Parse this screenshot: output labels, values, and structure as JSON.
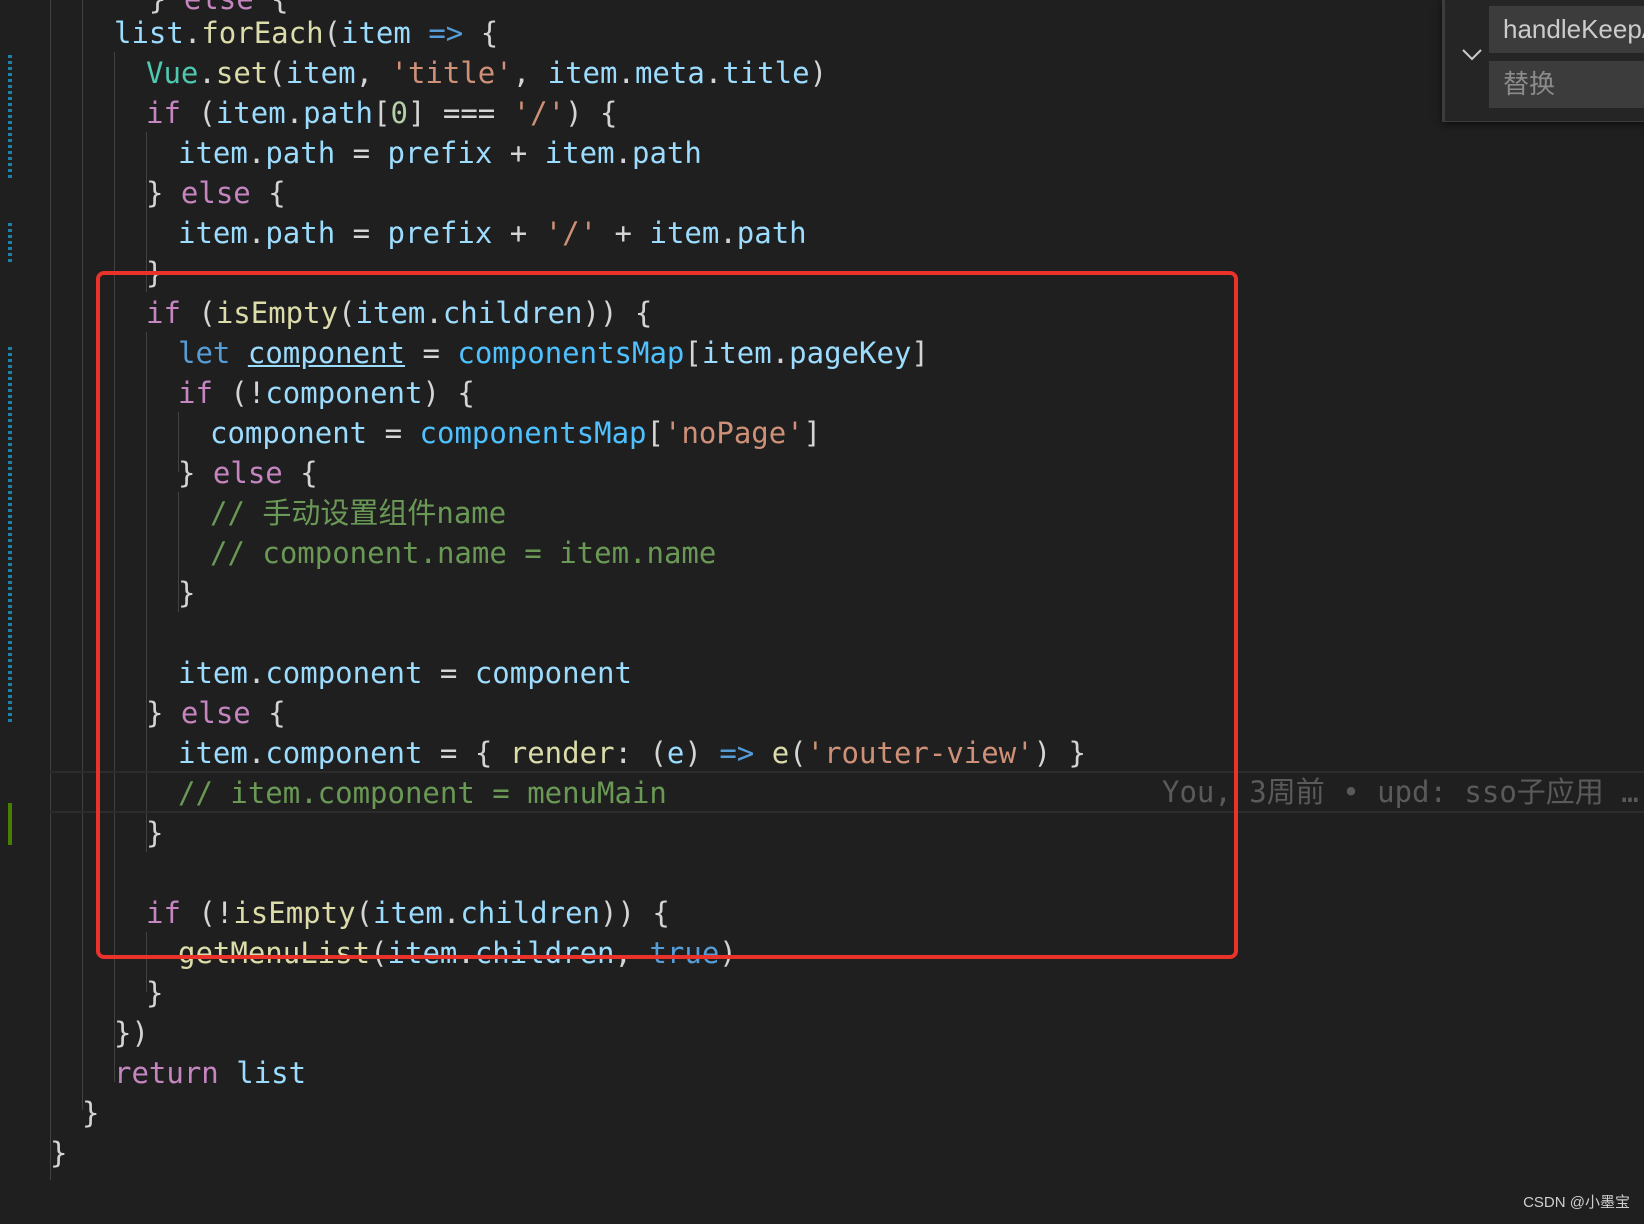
{
  "editor": {
    "lines": [
      [
        [
          "op",
          "  } "
        ],
        [
          "kw",
          "else"
        ],
        [
          "op",
          " {"
        ]
      ],
      [
        [
          "var",
          "list"
        ],
        [
          "op",
          "."
        ],
        [
          "fn",
          "forEach"
        ],
        [
          "op",
          "("
        ],
        [
          "var",
          "item"
        ],
        [
          "op",
          " "
        ],
        [
          "kwb",
          "=>"
        ],
        [
          "op",
          " {"
        ]
      ],
      [
        [
          "cls",
          "Vue"
        ],
        [
          "op",
          "."
        ],
        [
          "fn",
          "set"
        ],
        [
          "op",
          "("
        ],
        [
          "var",
          "item"
        ],
        [
          "op",
          ", "
        ],
        [
          "str",
          "'title'"
        ],
        [
          "op",
          ", "
        ],
        [
          "var",
          "item"
        ],
        [
          "op",
          "."
        ],
        [
          "var",
          "meta"
        ],
        [
          "op",
          "."
        ],
        [
          "var",
          "title"
        ],
        [
          "op",
          ")"
        ]
      ],
      [
        [
          "kw",
          "if"
        ],
        [
          "op",
          " ("
        ],
        [
          "var",
          "item"
        ],
        [
          "op",
          "."
        ],
        [
          "var",
          "path"
        ],
        [
          "op",
          "["
        ],
        [
          "num",
          "0"
        ],
        [
          "op",
          "] === "
        ],
        [
          "str",
          "'/'"
        ],
        [
          "op",
          ") {"
        ]
      ],
      [
        [
          "var",
          "item"
        ],
        [
          "op",
          "."
        ],
        [
          "var",
          "path"
        ],
        [
          "op",
          " = "
        ],
        [
          "var",
          "prefix"
        ],
        [
          "op",
          " + "
        ],
        [
          "var",
          "item"
        ],
        [
          "op",
          "."
        ],
        [
          "var",
          "path"
        ]
      ],
      [
        [
          "op",
          "} "
        ],
        [
          "kw",
          "else"
        ],
        [
          "op",
          " {"
        ]
      ],
      [
        [
          "var",
          "item"
        ],
        [
          "op",
          "."
        ],
        [
          "var",
          "path"
        ],
        [
          "op",
          " = "
        ],
        [
          "var",
          "prefix"
        ],
        [
          "op",
          " + "
        ],
        [
          "str",
          "'/'"
        ],
        [
          "op",
          " + "
        ],
        [
          "var",
          "item"
        ],
        [
          "op",
          "."
        ],
        [
          "var",
          "path"
        ]
      ],
      [
        [
          "op",
          "}"
        ]
      ],
      [
        [
          "kw",
          "if"
        ],
        [
          "op",
          " ("
        ],
        [
          "fn",
          "isEmpty"
        ],
        [
          "op",
          "("
        ],
        [
          "var",
          "item"
        ],
        [
          "op",
          "."
        ],
        [
          "var",
          "children"
        ],
        [
          "op",
          ")) {"
        ]
      ],
      [
        [
          "kwb",
          "let"
        ],
        [
          "op",
          " "
        ],
        [
          "var ul",
          "component"
        ],
        [
          "op",
          " = "
        ],
        [
          "cst",
          "componentsMap"
        ],
        [
          "op",
          "["
        ],
        [
          "var",
          "item"
        ],
        [
          "op",
          "."
        ],
        [
          "var",
          "pageKey"
        ],
        [
          "op",
          "]"
        ]
      ],
      [
        [
          "kw",
          "if"
        ],
        [
          "op",
          " (!"
        ],
        [
          "var",
          "component"
        ],
        [
          "op",
          ") {"
        ]
      ],
      [
        [
          "var",
          "component"
        ],
        [
          "op",
          " = "
        ],
        [
          "cst",
          "componentsMap"
        ],
        [
          "op",
          "["
        ],
        [
          "str",
          "'noPage'"
        ],
        [
          "op",
          "]"
        ]
      ],
      [
        [
          "op",
          "} "
        ],
        [
          "kw",
          "else"
        ],
        [
          "op",
          " {"
        ]
      ],
      [
        [
          "cmt",
          "// 手动设置组件name"
        ]
      ],
      [
        [
          "cmt",
          "// component.name = item.name"
        ]
      ],
      [
        [
          "op",
          "}"
        ]
      ],
      [],
      [
        [
          "var",
          "item"
        ],
        [
          "op",
          "."
        ],
        [
          "var",
          "component"
        ],
        [
          "op",
          " = "
        ],
        [
          "var",
          "component"
        ]
      ],
      [
        [
          "op",
          "} "
        ],
        [
          "kw",
          "else"
        ],
        [
          "op",
          " {"
        ]
      ],
      [
        [
          "var",
          "item"
        ],
        [
          "op",
          "."
        ],
        [
          "var",
          "component"
        ],
        [
          "op",
          " = { "
        ],
        [
          "fn",
          "render"
        ],
        [
          "op",
          ": ("
        ],
        [
          "var",
          "e"
        ],
        [
          "op",
          ") "
        ],
        [
          "kwb",
          "=>"
        ],
        [
          "op",
          " "
        ],
        [
          "fn",
          "e"
        ],
        [
          "op",
          "("
        ],
        [
          "str",
          "'router-view'"
        ],
        [
          "op",
          ") }"
        ]
      ],
      [
        [
          "cmt",
          "// item.component = menuMain"
        ]
      ],
      [
        [
          "op",
          "}"
        ]
      ],
      [],
      [
        [
          "kw",
          "if"
        ],
        [
          "op",
          " (!"
        ],
        [
          "fn",
          "isEmpty"
        ],
        [
          "op",
          "("
        ],
        [
          "var",
          "item"
        ],
        [
          "op",
          "."
        ],
        [
          "var",
          "children"
        ],
        [
          "op",
          ")) {"
        ]
      ],
      [
        [
          "fn",
          "getMenuList"
        ],
        [
          "op",
          "("
        ],
        [
          "var",
          "item"
        ],
        [
          "op",
          "."
        ],
        [
          "var",
          "children"
        ],
        [
          "op",
          ", "
        ],
        [
          "kwb",
          "true"
        ],
        [
          "op",
          ")"
        ]
      ],
      [
        [
          "op",
          "}"
        ]
      ],
      [
        [
          "op",
          "})"
        ]
      ],
      [
        [
          "kw",
          "return"
        ],
        [
          "op",
          " "
        ],
        [
          "var",
          "list"
        ]
      ],
      [
        [
          "op",
          "}"
        ]
      ],
      [
        [
          "op",
          "}"
        ]
      ]
    ],
    "blame": "You, 3周前 • upd: sso子应用 …"
  },
  "find_widget": {
    "find_value": "handleKeepAlive",
    "replace_placeholder": "替换"
  },
  "watermark": "CSDN @小墨宝",
  "colors": {
    "background": "#1f1f1f",
    "highlight_box": "#e8322a",
    "keyword": "#c586c0",
    "variable": "#9cdcfe",
    "function": "#dcdcaa",
    "string": "#ce9178",
    "comment": "#6a9955"
  }
}
